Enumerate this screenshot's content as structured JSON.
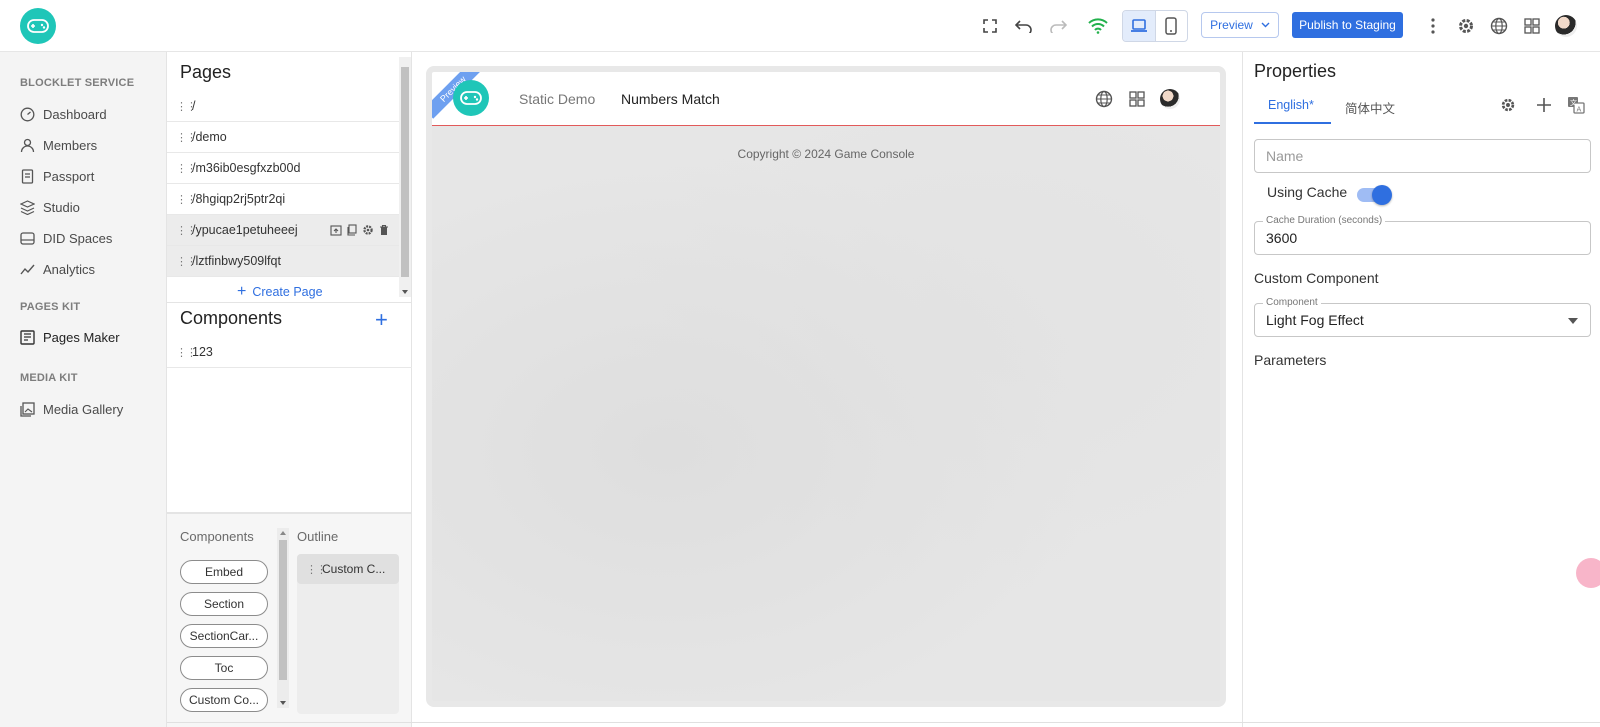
{
  "topbar": {
    "preview_label": "Preview",
    "publish_label": "Publish to Staging"
  },
  "leftnav": {
    "sections": [
      {
        "title": "BLOCKLET SERVICE",
        "items": [
          "Dashboard",
          "Members",
          "Passport",
          "Studio",
          "DID Spaces",
          "Analytics"
        ]
      },
      {
        "title": "PAGES KIT",
        "items": [
          "Pages Maker"
        ]
      },
      {
        "title": "MEDIA KIT",
        "items": [
          "Media Gallery"
        ]
      }
    ]
  },
  "pages": {
    "title": "Pages",
    "rows": [
      "/",
      "/demo",
      "/m36ib0esgfxzb00d",
      "/8hgiqp2rj5ptr2qi",
      "/ypucae1petuheeej",
      "/lztfinbwy509lfqt"
    ],
    "create_label": "Create Page"
  },
  "components": {
    "title": "Components",
    "rows": [
      "123"
    ]
  },
  "palette": {
    "components_label": "Components",
    "outline_label": "Outline",
    "pills": [
      "Embed",
      "Section",
      "SectionCar...",
      "Toc",
      "Custom Co..."
    ],
    "outline_item": "Custom C..."
  },
  "canvas": {
    "ribbon": "Preview",
    "nav": [
      "Static Demo",
      "Numbers Match"
    ],
    "copyright": "Copyright © 2024 Game Console"
  },
  "properties": {
    "title": "Properties",
    "tabs": [
      "English*",
      "简体中文"
    ],
    "name_placeholder": "Name",
    "using_cache_label": "Using Cache",
    "using_cache_on": true,
    "cache_duration_label": "Cache Duration (seconds)",
    "cache_duration_value": "3600",
    "custom_component_label": "Custom Component",
    "component_field_label": "Component",
    "component_value": "Light Fog Effect",
    "parameters_label": "Parameters"
  },
  "colors": {
    "accent": "#2f6fe0",
    "logo": "#1fc6b8",
    "wifi": "#22b14c"
  }
}
